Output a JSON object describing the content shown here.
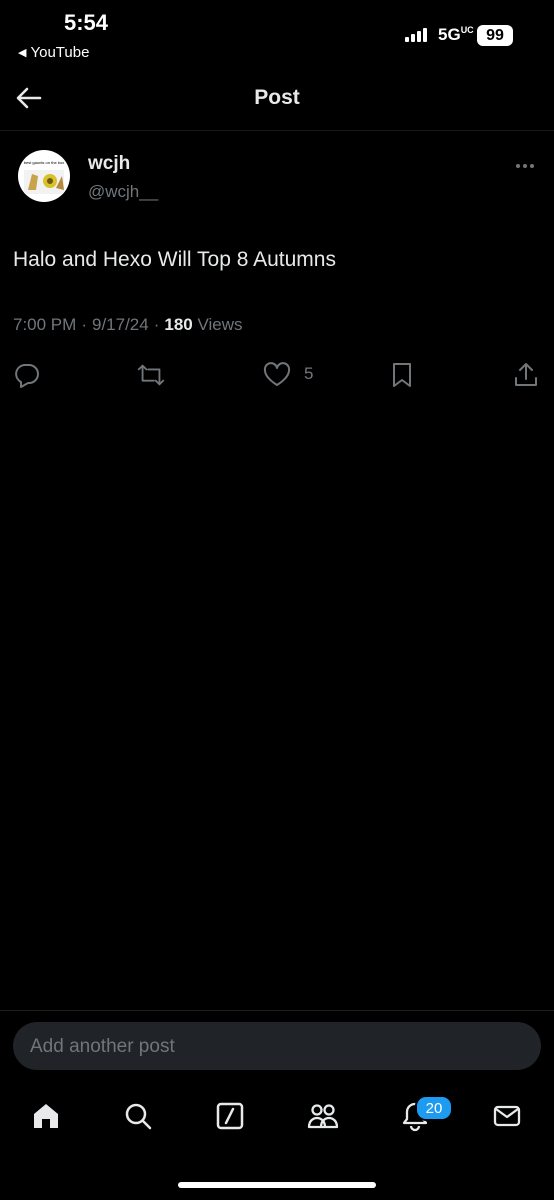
{
  "status_bar": {
    "time": "5:54",
    "back_app": "YouTube",
    "network": "5G",
    "network_suffix": "UC",
    "battery": "99"
  },
  "header": {
    "title": "Post"
  },
  "post": {
    "display_name": "wcjh",
    "handle": "@wcjh__",
    "avatar_caption": "best gaunts on the box",
    "text": "Halo and Hexo Will Top 8 Autumns",
    "time": "7:00 PM",
    "date": "9/17/24",
    "views_count": "180",
    "views_label": "Views",
    "like_count": "5"
  },
  "composer": {
    "placeholder": "Add another post"
  },
  "tabbar": {
    "notification_badge": "20"
  },
  "icons": [
    "back-arrow-icon",
    "more-icon",
    "reply-icon",
    "repost-icon",
    "like-icon",
    "bookmark-icon",
    "share-icon",
    "home-icon",
    "search-icon",
    "compose-icon",
    "communities-icon",
    "notifications-icon",
    "messages-icon"
  ],
  "colors": {
    "background": "#000000",
    "text": "#e7e9ea",
    "muted": "#71767b",
    "accent": "#1d9bf0"
  }
}
